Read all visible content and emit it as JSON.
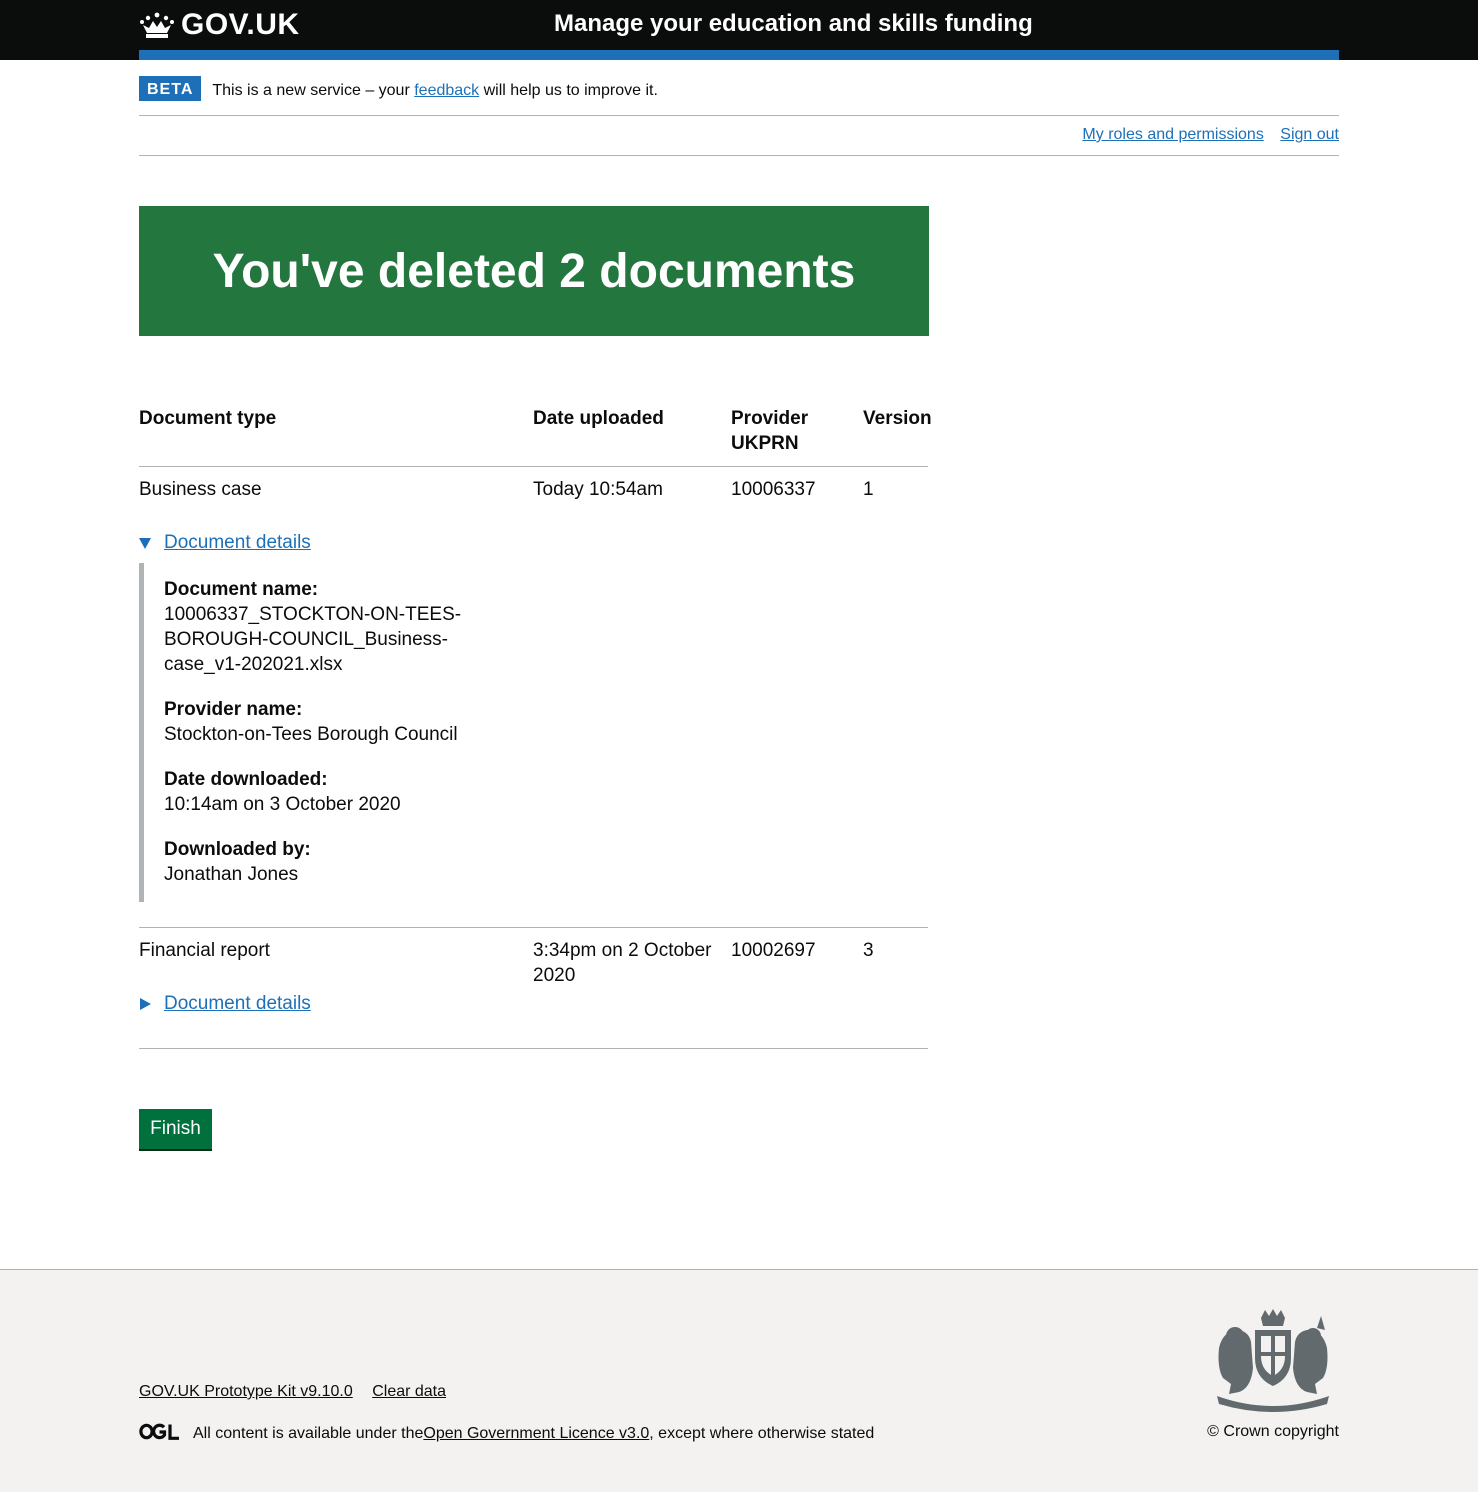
{
  "header": {
    "logo_text": "GOV.UK",
    "service_name": "Manage your education and skills funding"
  },
  "phase_banner": {
    "tag": "BETA",
    "text_before": "This is a new service – your ",
    "link": "feedback",
    "text_after": " will help us to improve it."
  },
  "top_nav": {
    "roles_link": "My roles and permissions",
    "sign_out_link": "Sign out"
  },
  "panel": {
    "title": "You've deleted 2 documents"
  },
  "table": {
    "headers": {
      "document_type": "Document type",
      "date_uploaded": "Date uploaded",
      "provider_ukprn_line1": "Provider",
      "provider_ukprn_line2": "UKPRN",
      "version": "Version"
    },
    "rows": [
      {
        "document_type": "Business case",
        "date_uploaded": "Today 10:54am",
        "ukprn": "10006337",
        "version": "1",
        "details_toggle": "Document details",
        "expanded": true,
        "details": {
          "document_name_label": "Document name:",
          "document_name_line1": "10006337_STOCKTON-ON-TEES-",
          "document_name_line2": "BOROUGH-COUNCIL_Business-",
          "document_name_line3": "case_v1-202021.xlsx",
          "provider_name_label": "Provider name:",
          "provider_name": "Stockton-on-Tees Borough Council",
          "date_downloaded_label": "Date downloaded:",
          "date_downloaded": "10:14am on 3 October 2020",
          "downloaded_by_label": "Downloaded by:",
          "downloaded_by": "Jonathan Jones"
        }
      },
      {
        "document_type": "Financial report",
        "date_uploaded_line1": "3:34pm on 2 October",
        "date_uploaded_line2": "2020",
        "ukprn": "10002697",
        "version": "3",
        "details_toggle": "Document details",
        "expanded": false
      }
    ]
  },
  "finish_button": "Finish",
  "footer": {
    "prototype_kit_link": "GOV.UK Prototype Kit v9.10.0",
    "clear_data_link": "Clear data",
    "licence_text_before": "All content is available under the ",
    "licence_link": "Open Government Licence v3.0",
    "licence_text_after": ", except where otherwise stated",
    "copyright": "© Crown copyright"
  },
  "colors": {
    "header_bg": "#0b0c0c",
    "brand_blue": "#1d70b8",
    "panel_green": "#24763f",
    "button_green": "#00703c",
    "footer_bg": "#f3f2f1",
    "border_grey": "#b1b4b6"
  },
  "icons": {
    "logo": "crown-icon",
    "footer_licence": "ogl-logo",
    "footer_crest": "royal-coat-of-arms"
  }
}
